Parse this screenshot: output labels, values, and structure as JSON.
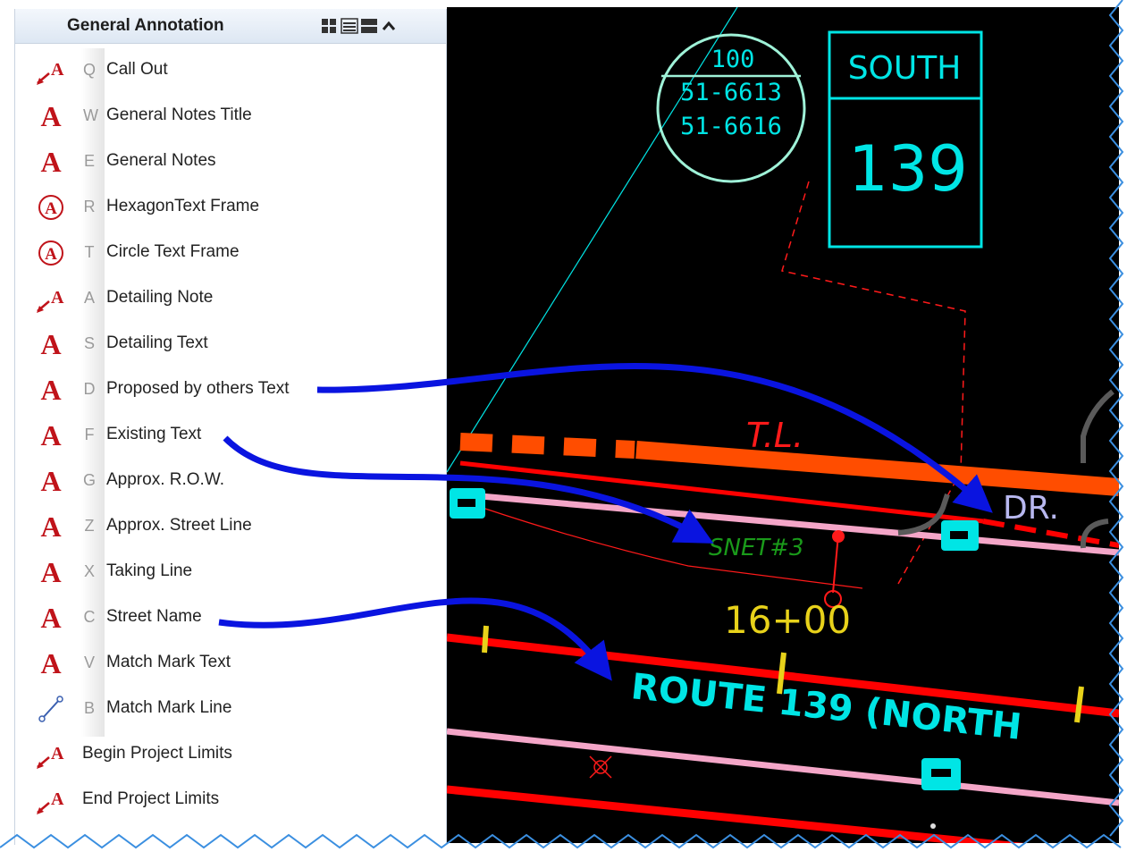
{
  "panel": {
    "title": "General Annotation",
    "view_buttons": [
      "grid-view-icon",
      "list-view-icon",
      "detail-view-icon",
      "collapse-up-icon"
    ],
    "items": [
      {
        "key": "Q",
        "label": "Call Out",
        "icon": "callout-arrow-icon"
      },
      {
        "key": "W",
        "label": "General Notes Title",
        "icon": "text-a-icon"
      },
      {
        "key": "E",
        "label": "General Notes",
        "icon": "text-a-icon"
      },
      {
        "key": "R",
        "label": "HexagonText Frame",
        "icon": "circled-a-icon"
      },
      {
        "key": "T",
        "label": "Circle Text Frame",
        "icon": "circled-a-icon"
      },
      {
        "key": "A",
        "label": "Detailing Note",
        "icon": "callout-arrow-icon"
      },
      {
        "key": "S",
        "label": "Detailing Text",
        "icon": "text-a-icon"
      },
      {
        "key": "D",
        "label": "Proposed by others Text",
        "icon": "text-a-icon"
      },
      {
        "key": "F",
        "label": "Existing Text",
        "icon": "text-a-icon"
      },
      {
        "key": "G",
        "label": "Approx. R.O.W.",
        "icon": "text-a-icon"
      },
      {
        "key": "Z",
        "label": "Approx. Street Line",
        "icon": "text-a-icon"
      },
      {
        "key": "X",
        "label": "Taking Line",
        "icon": "text-a-icon"
      },
      {
        "key": "C",
        "label": "Street Name",
        "icon": "text-a-icon"
      },
      {
        "key": "V",
        "label": "Match Mark Text",
        "icon": "text-a-icon"
      },
      {
        "key": "B",
        "label": "Match Mark Line",
        "icon": "line-icon"
      },
      {
        "key": "",
        "label": "Begin Project Limits",
        "icon": "callout-arrow-icon"
      },
      {
        "key": "",
        "label": "End Project Limits",
        "icon": "callout-arrow-icon"
      }
    ]
  },
  "cad": {
    "circle_label": {
      "top": "100",
      "line1": "51-6613",
      "line2": "51-6616"
    },
    "sheet_box": {
      "top": "SOUTH",
      "number": "139"
    },
    "tl_label": "T.L.",
    "dr_label": "DR.",
    "snet_label": "SNET#3",
    "station_label": "16+00",
    "route_label": "ROUTE 139 (NORTH"
  },
  "colors": {
    "cyan": "#00e5e5",
    "orange": "#ff4d00",
    "red": "#ff0000",
    "pink": "#f4a6c8",
    "arrow": "#0a14e0",
    "yellow": "#e8d21a",
    "green": "#1a9a1a",
    "lilac": "#b8b8f0"
  }
}
